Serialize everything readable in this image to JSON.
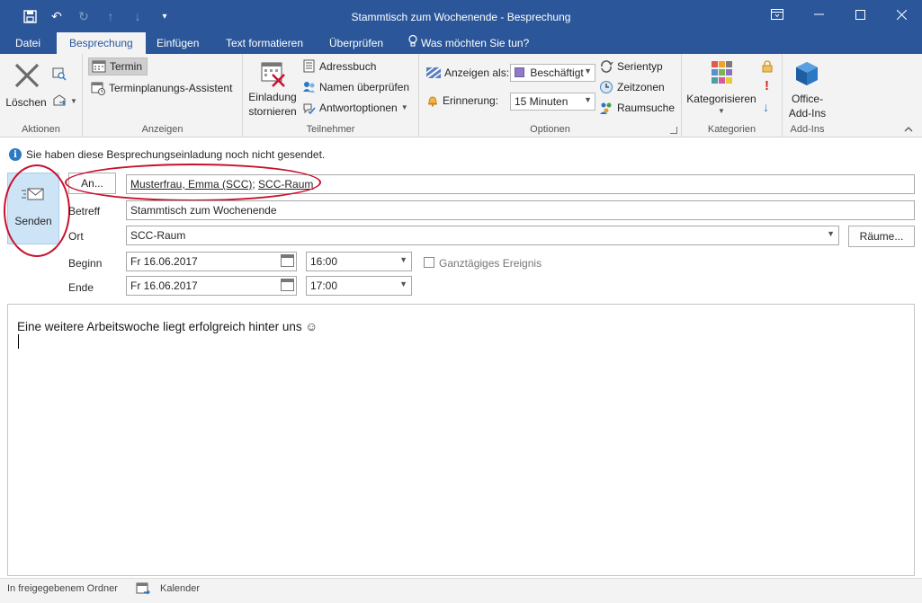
{
  "window": {
    "title": "Stammtisch zum Wochenende - Besprechung",
    "controls": [
      "restore-ribbon",
      "minimize",
      "maximize",
      "close"
    ]
  },
  "tabs": [
    {
      "label": "Datei",
      "active": false
    },
    {
      "label": "Besprechung",
      "active": true
    },
    {
      "label": "Einfügen",
      "active": false
    },
    {
      "label": "Text formatieren",
      "active": false
    },
    {
      "label": "Überprüfen",
      "active": false
    },
    {
      "label": "Was möchten Sie tun?",
      "active": false
    }
  ],
  "ribbon": {
    "aktionen": {
      "label": "Aktionen",
      "delete": "Löschen"
    },
    "anzeigen": {
      "label": "Anzeigen",
      "termin": "Termin",
      "assistent": "Terminplanungs-Assistent"
    },
    "teilnehmer": {
      "label": "Teilnehmer",
      "cancel_line1": "Einladung",
      "cancel_line2": "stornieren",
      "addressbook": "Adressbuch",
      "check_names": "Namen überprüfen",
      "response_options": "Antwortoptionen"
    },
    "optionen": {
      "label": "Optionen",
      "show_as_label": "Anzeigen als:",
      "show_as_value": "Beschäftigt",
      "reminder_label": "Erinnerung:",
      "reminder_value": "15 Minuten",
      "recurrence": "Serientyp",
      "timezones": "Zeitzonen",
      "room_finder": "Raumsuche"
    },
    "kategorien": {
      "label": "Kategorien",
      "categorize": "Kategorisieren"
    },
    "addins": {
      "label": "Add-Ins",
      "line1": "Office-",
      "line2": "Add-Ins"
    }
  },
  "info": {
    "text": "Sie haben diese Besprechungseinladung noch nicht gesendet."
  },
  "form": {
    "send_label": "Senden",
    "to_button": "An...",
    "recipients": [
      "Musterfrau, Emma (SCC)",
      "SCC-Raum"
    ],
    "subject_label": "Betreff",
    "subject": "Stammtisch zum Wochenende",
    "location_label": "Ort",
    "location": "SCC-Raum",
    "rooms_button": "Räume...",
    "start_label": "Beginn",
    "start_date": "Fr 16.06.2017",
    "start_time": "16:00",
    "allday_label": "Ganztägiges Ereignis",
    "allday_checked": false,
    "end_label": "Ende",
    "end_date": "Fr 16.06.2017",
    "end_time": "17:00"
  },
  "body": {
    "text": "Eine weitere Arbeitswoche liegt erfolgreich hinter uns ☺"
  },
  "status": {
    "folder": "In freigegebenem Ordner",
    "calendar": "Kalender"
  },
  "colors": {
    "accent": "#2b579a",
    "highlight_ring": "#c8102e",
    "send_bg": "#cde4f7"
  }
}
